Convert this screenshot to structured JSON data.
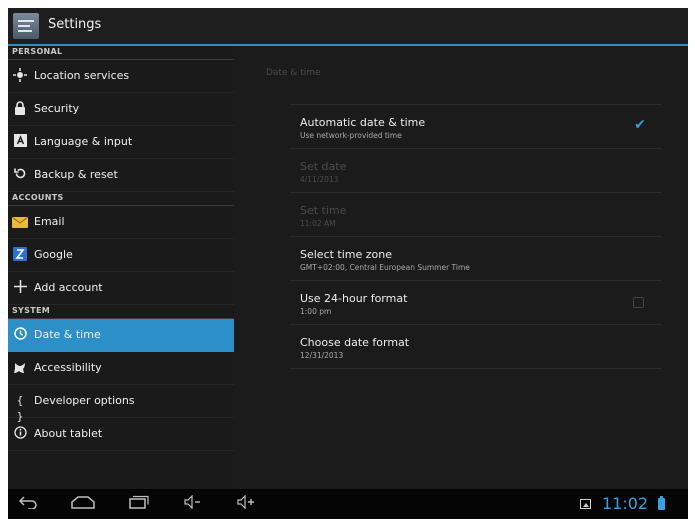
{
  "action_bar": {
    "title": "Settings"
  },
  "sidebar": {
    "headers": {
      "personal": "PERSONAL",
      "accounts": "ACCOUNTS",
      "system": "SYSTEM"
    },
    "personal": [
      {
        "label": "Location services",
        "icon": "location-icon"
      },
      {
        "label": "Security",
        "icon": "lock-icon"
      },
      {
        "label": "Language & input",
        "icon": "keyboard-icon"
      },
      {
        "label": "Backup & reset",
        "icon": "backup-icon"
      }
    ],
    "accounts": [
      {
        "label": "Email",
        "icon": "email-icon"
      },
      {
        "label": "Google",
        "icon": "google-icon"
      },
      {
        "label": "Add account",
        "icon": "plus-icon"
      }
    ],
    "system": [
      {
        "label": "Date & time",
        "icon": "clock-icon",
        "selected": true
      },
      {
        "label": "Accessibility",
        "icon": "accessibility-icon"
      },
      {
        "label": "Developer options",
        "icon": "braces-icon"
      },
      {
        "label": "About tablet",
        "icon": "info-icon"
      }
    ]
  },
  "date_time": {
    "section_title": "Date & time",
    "automatic": {
      "title": "Automatic date & time",
      "summary": "Use network-provided time",
      "checked": true
    },
    "set_date": {
      "title": "Set date",
      "summary": "4/11/2013",
      "enabled": false
    },
    "set_time": {
      "title": "Set time",
      "summary": "11:02 AM",
      "enabled": false
    },
    "time_zone": {
      "title": "Select time zone",
      "summary": "GMT+02:00, Central European Summer Time"
    },
    "hour24": {
      "title": "Use 24-hour format",
      "summary": "1:00 pm",
      "checked": false
    },
    "date_format": {
      "title": "Choose date format",
      "summary": "12/31/2013"
    }
  },
  "status": {
    "time": "11:02"
  },
  "colors": {
    "accent": "#2c8fc8",
    "clock": "#39a0e0",
    "background": "#1b1b1b"
  }
}
